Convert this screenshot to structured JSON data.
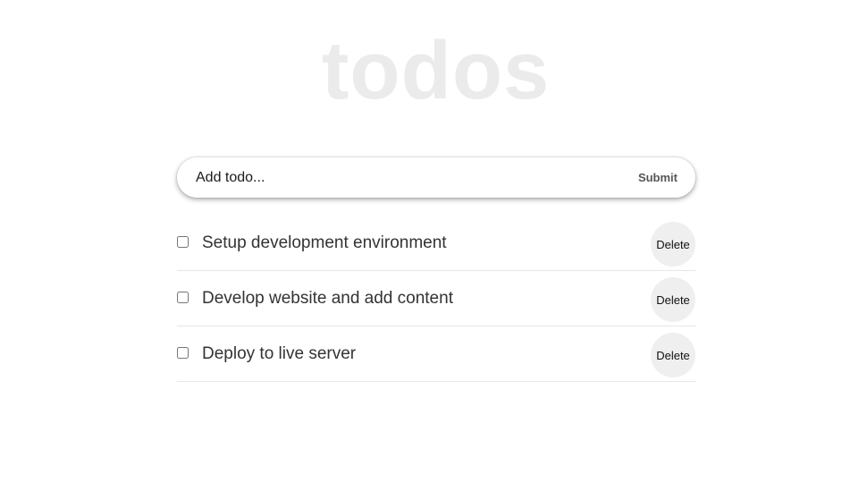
{
  "app": {
    "title": "todos"
  },
  "add_form": {
    "placeholder": "Add todo...",
    "value": "",
    "submit_label": "Submit"
  },
  "todos": [
    {
      "text": "Setup development environment",
      "checked": false,
      "delete_label": "Delete"
    },
    {
      "text": "Develop website and add content",
      "checked": false,
      "delete_label": "Delete"
    },
    {
      "text": "Deploy to live server",
      "checked": false,
      "delete_label": "Delete"
    }
  ]
}
